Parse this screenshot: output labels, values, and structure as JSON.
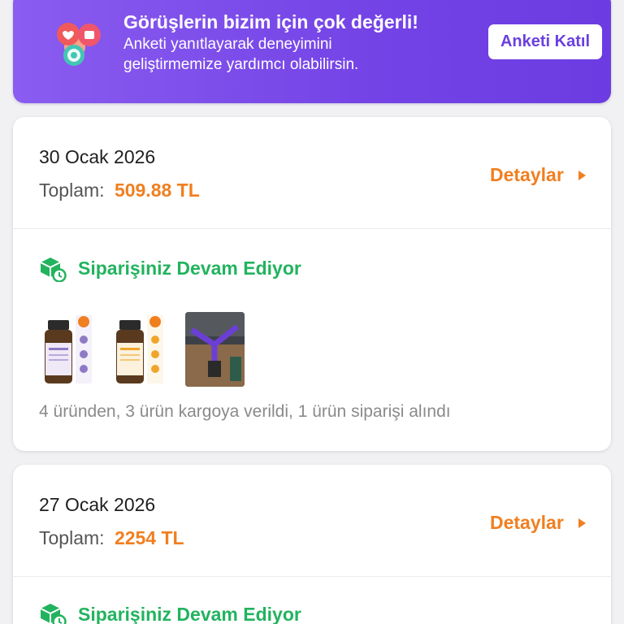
{
  "banner": {
    "title": "Görüşlerin bizim için çok değerli!",
    "subtitle": "Anketi yanıtlayarak deneyimini geliştirmemize yardımcı olabilirsin.",
    "button_label": "Anketi Katıl",
    "icon": "feedback-bubbles-icon"
  },
  "orders": [
    {
      "date": "30 Ocak 2026",
      "total_label": "Toplam:",
      "total_value": "509.88 TL",
      "details_label": "Detaylar",
      "status": "Siparişiniz Devam Ediyor",
      "status_icon": "package-clock-icon",
      "products": [
        {
          "type": "essential-oil",
          "name": "LAVANTA YAĞI",
          "accent": "#8e7ac4"
        },
        {
          "type": "essential-oil",
          "name": "PORTAKAL YAĞI",
          "accent": "#f0a52a"
        },
        {
          "type": "photo",
          "name": "purple-frame-product"
        }
      ],
      "summary": "4 üründen, 3 ürün kargoya verildi, 1 ürün siparişi alındı"
    },
    {
      "date": "27 Ocak 2026",
      "total_label": "Toplam:",
      "total_value": "2254 TL",
      "details_label": "Detaylar",
      "status": "Siparişiniz Devam Ediyor",
      "status_icon": "package-clock-icon"
    }
  ],
  "colors": {
    "banner": "#7443e6",
    "accent_orange": "#f07f20",
    "status_green": "#22b35e"
  }
}
